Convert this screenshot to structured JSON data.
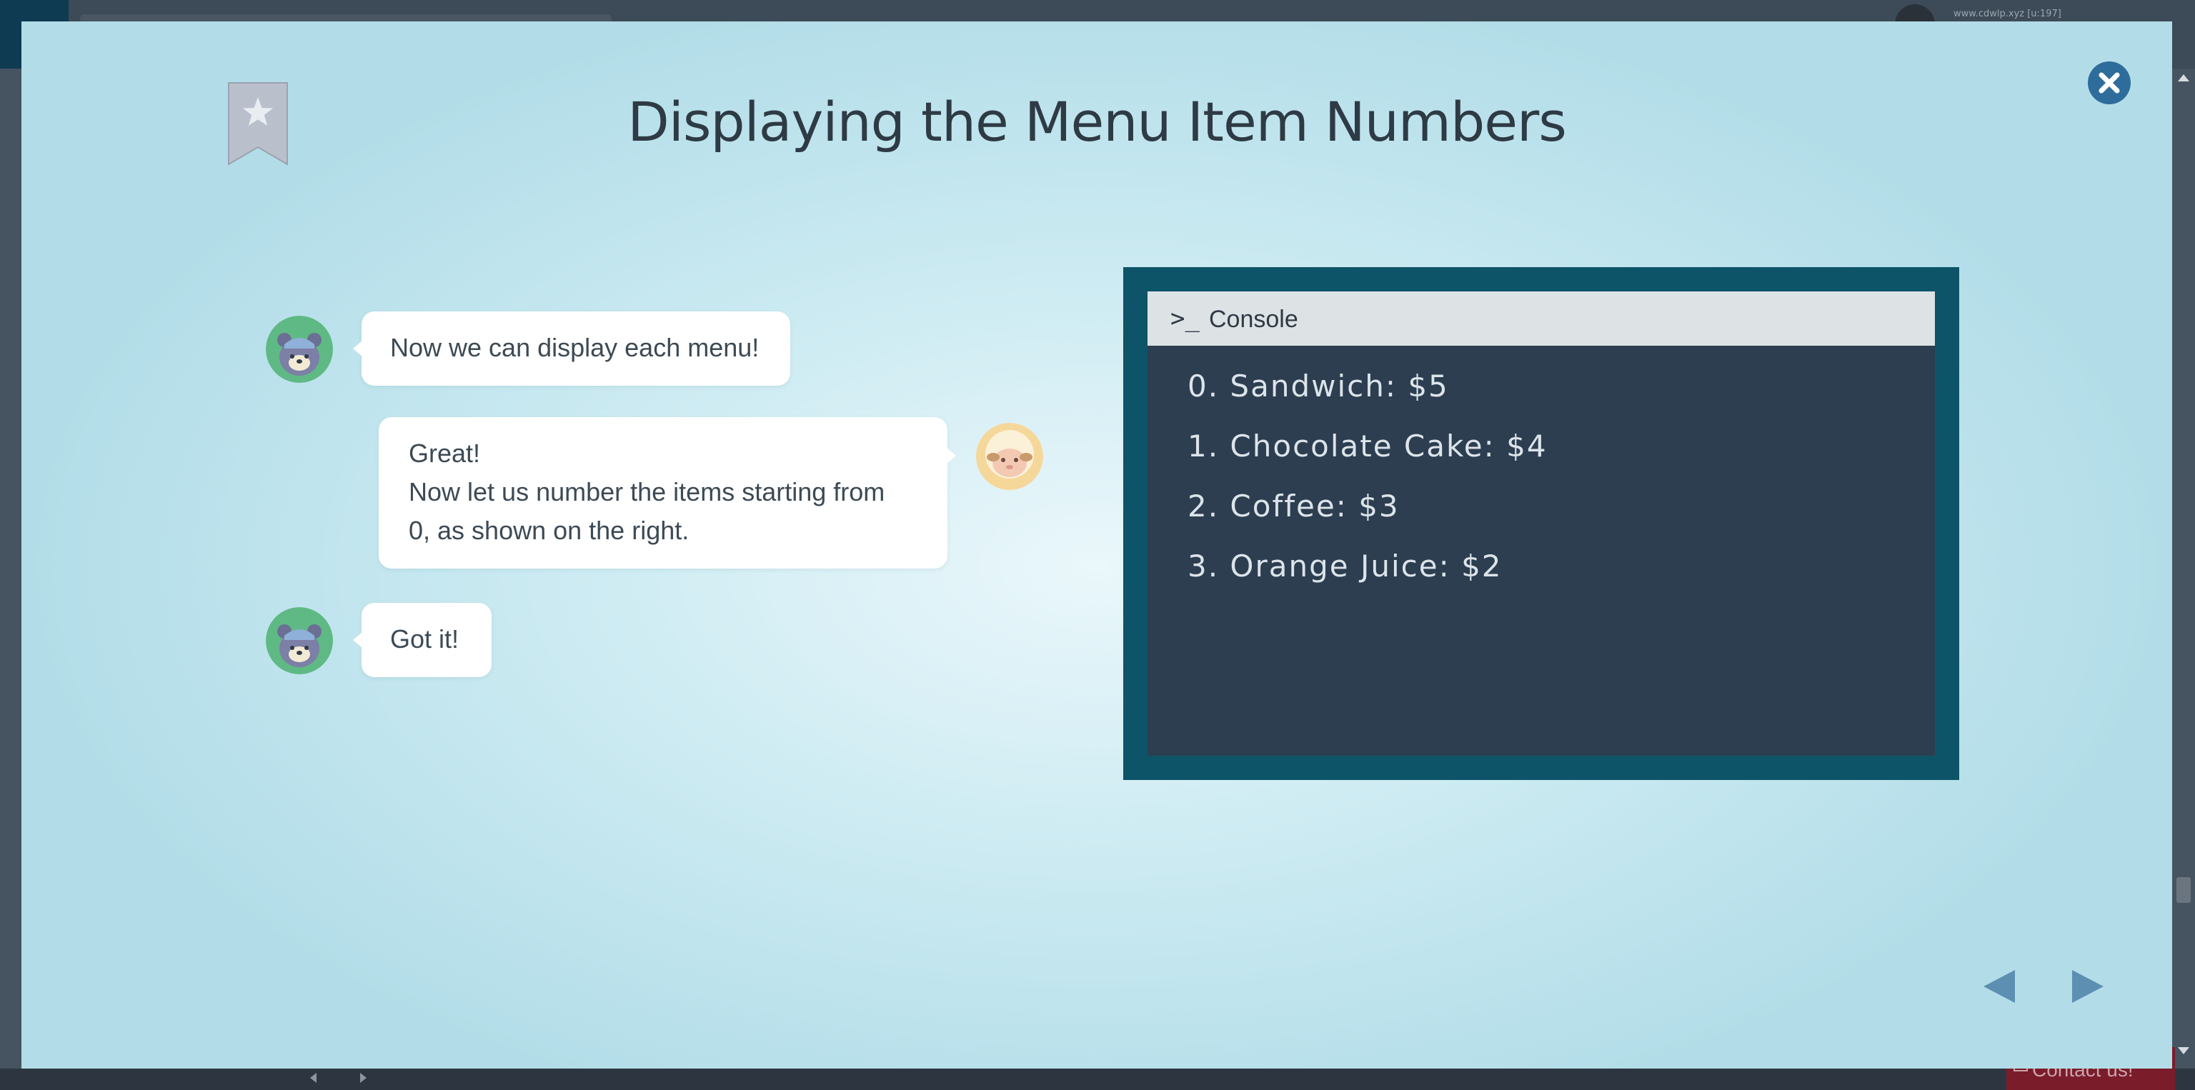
{
  "background": {
    "url_text": "www.cdwlp.xyz [u:197]",
    "contact_label": "Contact us!"
  },
  "modal": {
    "title": "Displaying the Menu Item Numbers",
    "bookmark_icon": "bookmark-star-icon",
    "close_icon": "close-x-icon"
  },
  "chat": {
    "messages": [
      {
        "speaker": "bear",
        "lines": [
          "Now we can display each menu!"
        ]
      },
      {
        "speaker": "sheep",
        "lines": [
          "Great!",
          "Now let us number the items starting from",
          "0, as shown on the right."
        ]
      },
      {
        "speaker": "bear",
        "lines": [
          "Got it!"
        ]
      }
    ]
  },
  "console": {
    "prompt_symbol": ">_",
    "title": "Console",
    "output": [
      "0. Sandwich: $5",
      "1. Chocolate Cake: $4",
      "2. Coffee: $3",
      "3. Orange Juice: $2"
    ]
  },
  "navigation": {
    "prev_icon": "triangle-left-icon",
    "next_icon": "triangle-right-icon"
  },
  "colors": {
    "title_text": "#2e3a44",
    "console_frame": "#0e5468",
    "console_body": "#2c3e50",
    "close_button": "#2e6d9b",
    "nav_arrows": "#5d8fb2",
    "bear_avatar_bg": "#5fb984",
    "sheep_avatar_bg": "#f6d79a"
  }
}
